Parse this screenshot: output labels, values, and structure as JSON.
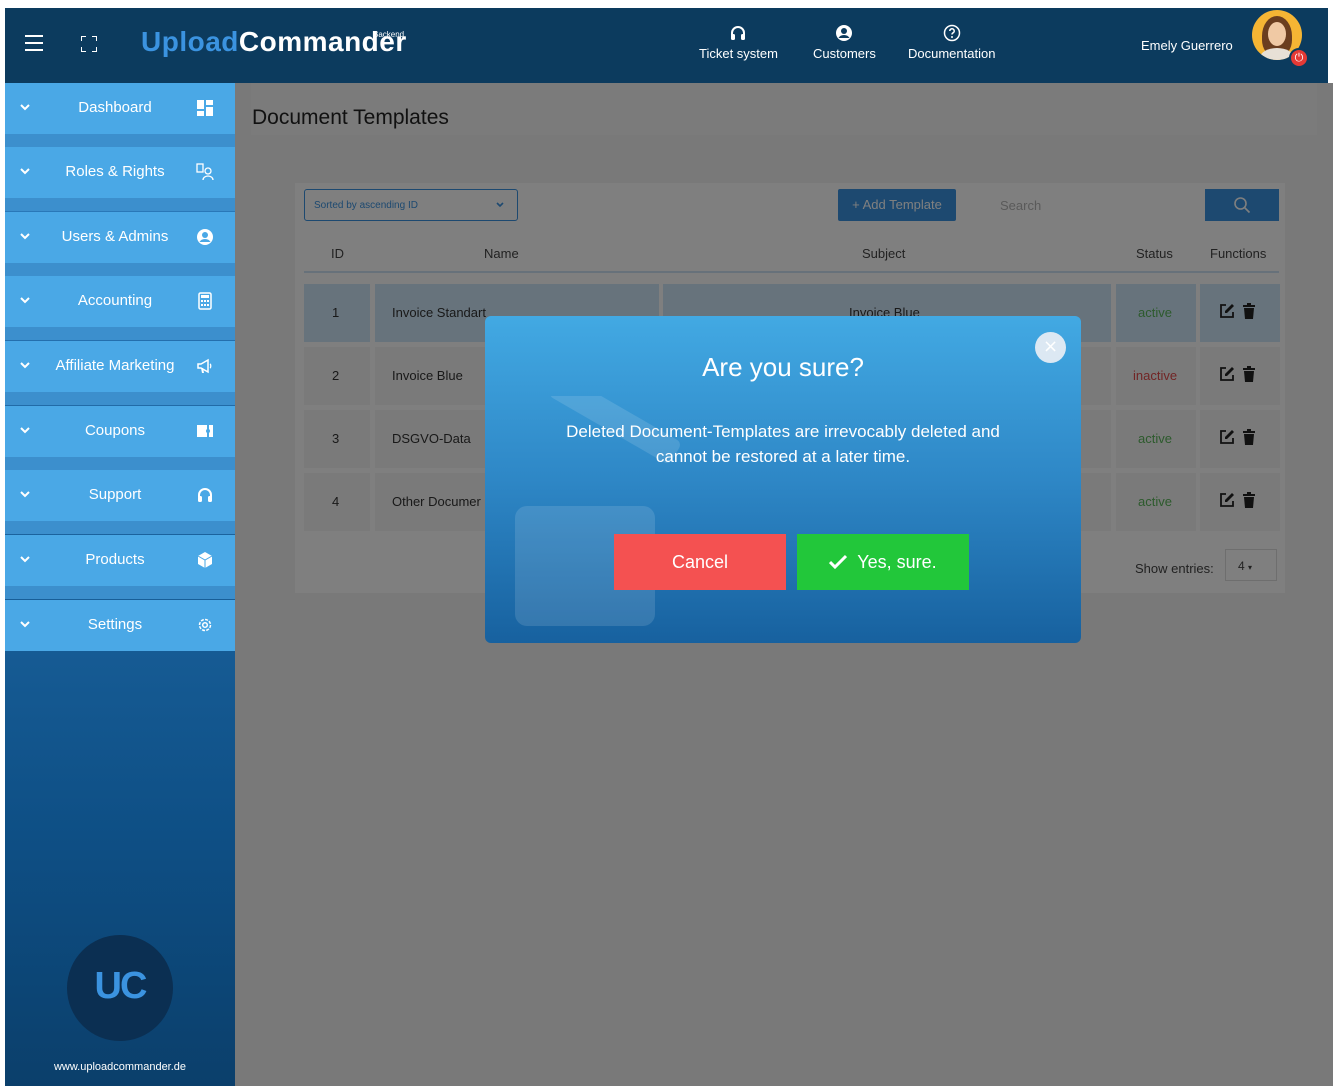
{
  "app": {
    "brand_prefix": "Upload",
    "brand_suffix": "Commander",
    "brand_sup": "Backend"
  },
  "header": {
    "nav": [
      {
        "label": "Ticket system",
        "icon": "headset-icon"
      },
      {
        "label": "Customers",
        "icon": "user-circle-icon"
      },
      {
        "label": "Documentation",
        "icon": "question-circle-icon"
      }
    ],
    "user_name": "Emely Guerrero"
  },
  "sidebar": {
    "items": [
      {
        "label": "Dashboard",
        "icon": "dashboard-icon"
      },
      {
        "label": "Roles & Rights",
        "icon": "roles-icon"
      },
      {
        "label": "Users & Admins",
        "icon": "user-icon"
      },
      {
        "label": "Accounting",
        "icon": "calculator-icon"
      },
      {
        "label": "Affiliate Marketing",
        "icon": "megaphone-icon"
      },
      {
        "label": "Coupons",
        "icon": "coupon-icon"
      },
      {
        "label": "Support",
        "icon": "headset-icon"
      },
      {
        "label": "Products",
        "icon": "cube-icon"
      },
      {
        "label": "Settings",
        "icon": "gear-icon"
      }
    ],
    "logo_text": "UC",
    "site_url": "www.uploadcommander.de"
  },
  "page": {
    "title": "Document Templates",
    "sort_label": "Sorted by ascending ID",
    "add_button": "+ Add Template",
    "search_placeholder": "Search",
    "columns": [
      "ID",
      "Name",
      "Subject",
      "Status",
      "Functions"
    ],
    "rows": [
      {
        "id": "1",
        "name": "Invoice Standart",
        "subject": "Invoice Blue",
        "status": "active"
      },
      {
        "id": "2",
        "name": "Invoice Blue",
        "subject": "",
        "status": "inactive"
      },
      {
        "id": "3",
        "name": "DSGVO-Data",
        "subject": "",
        "status": "active"
      },
      {
        "id": "4",
        "name": "Other Documer",
        "subject": "",
        "status": "active"
      }
    ],
    "show_entries_label": "Show entries:",
    "entries_value": "4"
  },
  "modal": {
    "title": "Are you sure?",
    "body": "Deleted Document-Templates are irrevocably deleted and cannot be restored at a later time.",
    "cancel": "Cancel",
    "confirm": "Yes, sure."
  },
  "colors": {
    "header_bg": "#0c3b5e",
    "sidebar_item": "#4aa8e6",
    "accent": "#3b93e0",
    "cancel": "#f45151",
    "confirm": "#22c73a",
    "active": "#5ab55a",
    "inactive": "#e24b4b"
  }
}
